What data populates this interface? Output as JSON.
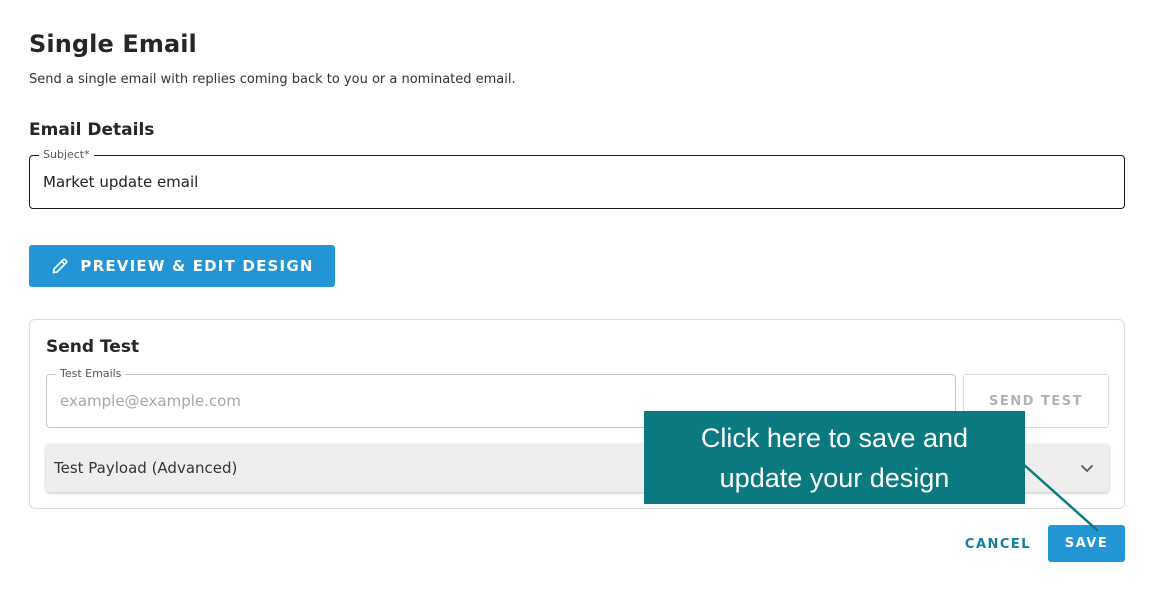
{
  "page": {
    "title": "Single Email",
    "description": "Send a single email with replies coming back to you or a nominated email."
  },
  "email_details": {
    "section_title": "Email Details",
    "subject": {
      "label": "Subject*",
      "value": "Market update email"
    },
    "preview_button": {
      "label": "PREVIEW & EDIT DESIGN",
      "icon": "pencil-icon"
    }
  },
  "send_test": {
    "title": "Send Test",
    "test_emails": {
      "label": "Test Emails",
      "placeholder": "example@example.com",
      "value": ""
    },
    "send_button_label": "SEND TEST",
    "payload_accordion": {
      "label": "Test Payload (Advanced)",
      "icon": "chevron-down-icon"
    }
  },
  "footer": {
    "cancel_label": "CANCEL",
    "save_label": "SAVE"
  },
  "tooltip": {
    "text": "Click here to save and\nupdate your design"
  },
  "colors": {
    "primary": "#2395d4",
    "accent_text": "#0f7f9a",
    "tooltip_bg": "#0b7a80"
  }
}
